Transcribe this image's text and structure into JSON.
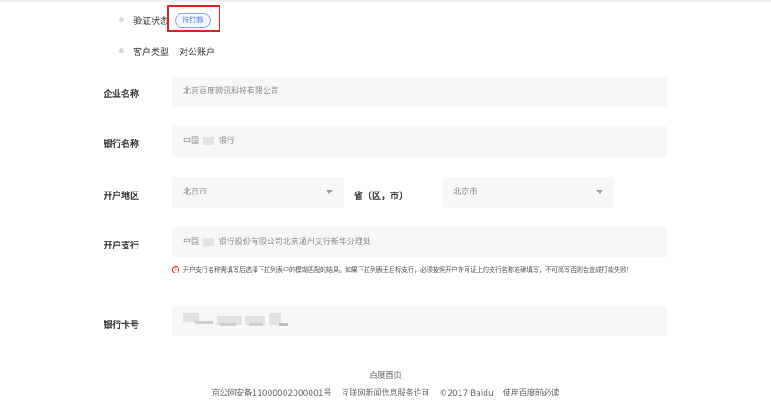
{
  "verification": {
    "label": "验证状态",
    "status": "待打款"
  },
  "customer_type": {
    "label": "客户类型",
    "value": "对公账户"
  },
  "company_name": {
    "label": "企业名称",
    "value": "北京百度网讯科技有限公司"
  },
  "bank_name": {
    "label": "银行名称",
    "value_prefix": "中国",
    "value_suffix": "银行"
  },
  "region": {
    "label": "开户地区",
    "province_value": "北京市",
    "province_suffix": "省（区，市）",
    "city_value": "北京市"
  },
  "branch": {
    "label": "开户支行",
    "value_prefix": "中国",
    "value_suffix": "银行股份有限公司北京通州支行新华分理处",
    "warning": "开户支行名称需填写后选择下拉列表中的模糊匹配的结果。如果下拉列表无目标支行，必须按照开户许可证上的支行名称准确填写，不可简写否则会造成打款失败！"
  },
  "card_number": {
    "label": "银行卡号"
  },
  "footer": {
    "home_link": "百度首页",
    "icp": "京公网安备11000002000001号",
    "license": "互联网新闻信息服务许可",
    "copyright": "©2017 Baidu",
    "terms": "使用百度前必读"
  },
  "colors": {
    "highlight": "#e02020",
    "badge_text": "#3a6fd8",
    "field_bg": "#f7f7f7"
  }
}
